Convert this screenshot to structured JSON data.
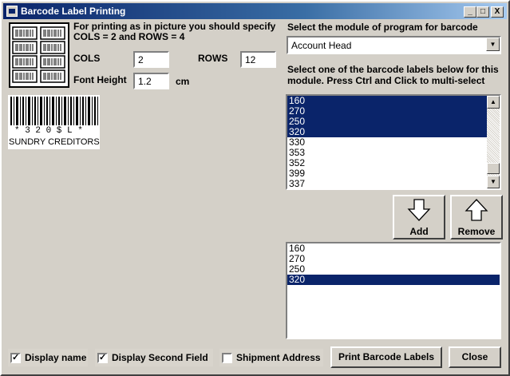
{
  "window": {
    "title": "Barcode Label Printing"
  },
  "title_buttons": {
    "minimize": "_",
    "maximize": "□",
    "close": "X"
  },
  "left": {
    "instructions": "For printing as in picture you should specify\nCOLS = 2 and ROWS = 4",
    "cols_label": "COLS",
    "cols_value": "2",
    "rows_label": "ROWS",
    "rows_value": "12",
    "font_height_label": "Font Height",
    "font_height_value": "1.2",
    "font_unit": "cm",
    "barcode_text": "* 3 2 0 $ L *",
    "barcode_caption": "SUNDRY CREDITORS"
  },
  "right": {
    "module_label": "Select the module of program for barcode",
    "module_selected": "Account Head",
    "labels_instruction": "Select one of the barcode labels below for this\nmodule. Press Ctrl and Click to multi-select",
    "available": [
      {
        "text": "160",
        "selected": true
      },
      {
        "text": "270",
        "selected": true
      },
      {
        "text": "250",
        "selected": true
      },
      {
        "text": "320",
        "selected": true
      },
      {
        "text": "330",
        "selected": false
      },
      {
        "text": "353",
        "selected": false
      },
      {
        "text": "352",
        "selected": false
      },
      {
        "text": "399",
        "selected": false
      },
      {
        "text": "337",
        "selected": false
      }
    ],
    "add_label": "Add",
    "remove_label": "Remove",
    "chosen": [
      {
        "text": "160",
        "selected": false
      },
      {
        "text": "270",
        "selected": false
      },
      {
        "text": "250",
        "selected": false
      },
      {
        "text": "320",
        "selected": true
      }
    ]
  },
  "bottom": {
    "display_name": {
      "label": "Display name",
      "checked": true
    },
    "display_second": {
      "label": "Display Second Field",
      "checked": true
    },
    "shipment": {
      "label": "Shipment Address",
      "checked": false
    },
    "print_label": "Print Barcode Labels",
    "close_label": "Close"
  },
  "colors": {
    "selection": "#0a246a",
    "face": "#d4d0c8",
    "title_start": "#0a246a"
  }
}
